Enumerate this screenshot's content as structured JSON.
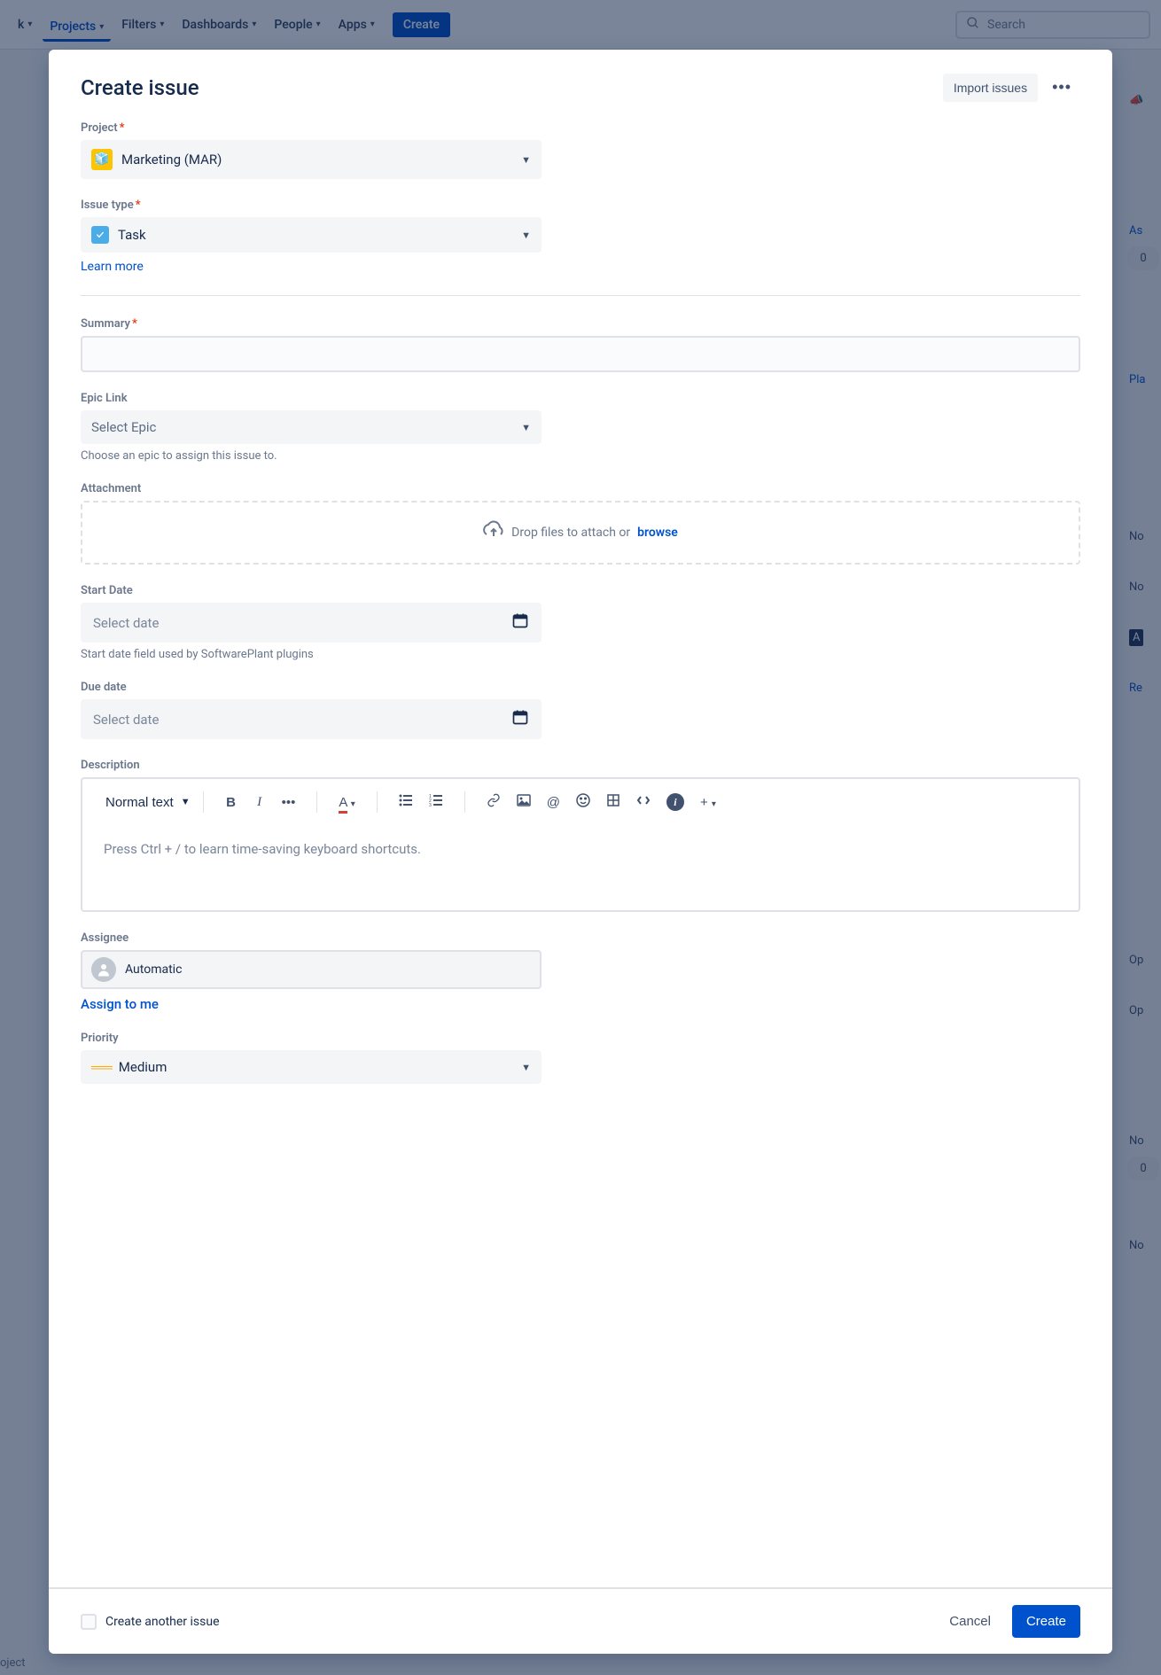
{
  "nav": {
    "work_prefix": "k",
    "projects": "Projects",
    "filters": "Filters",
    "dashboards": "Dashboards",
    "people": "People",
    "apps": "Apps",
    "create": "Create",
    "search_placeholder": "Search"
  },
  "modal": {
    "title": "Create issue",
    "import": "Import issues"
  },
  "fields": {
    "project": {
      "label": "Project",
      "value": "Marketing (MAR)"
    },
    "issue_type": {
      "label": "Issue type",
      "value": "Task",
      "learn_more": "Learn more"
    },
    "summary": {
      "label": "Summary"
    },
    "epic_link": {
      "label": "Epic Link",
      "placeholder": "Select Epic",
      "helper": "Choose an epic to assign this issue to."
    },
    "attachment": {
      "label": "Attachment",
      "drop_text": "Drop files to attach or ",
      "browse": "browse"
    },
    "start_date": {
      "label": "Start Date",
      "placeholder": "Select date",
      "helper": "Start date field used by SoftwarePlant plugins"
    },
    "due_date": {
      "label": "Due date",
      "placeholder": "Select date"
    },
    "description": {
      "label": "Description",
      "text_style": "Normal text",
      "placeholder": "Press Ctrl + / to learn time-saving keyboard shortcuts."
    },
    "assignee": {
      "label": "Assignee",
      "value": "Automatic",
      "assign_to_me": "Assign to me"
    },
    "priority": {
      "label": "Priority",
      "value": "Medium"
    }
  },
  "footer": {
    "create_another": "Create another issue",
    "cancel": "Cancel",
    "create": "Create"
  },
  "bg": {
    "assignee": "As",
    "planning": "Pla",
    "none1": "No",
    "none2": "No",
    "a_badge": "A",
    "re": "Re",
    "open1": "Op",
    "open2": "Op",
    "none3": "No",
    "zero": "0",
    "none4": "No",
    "project_footer": "oject"
  }
}
